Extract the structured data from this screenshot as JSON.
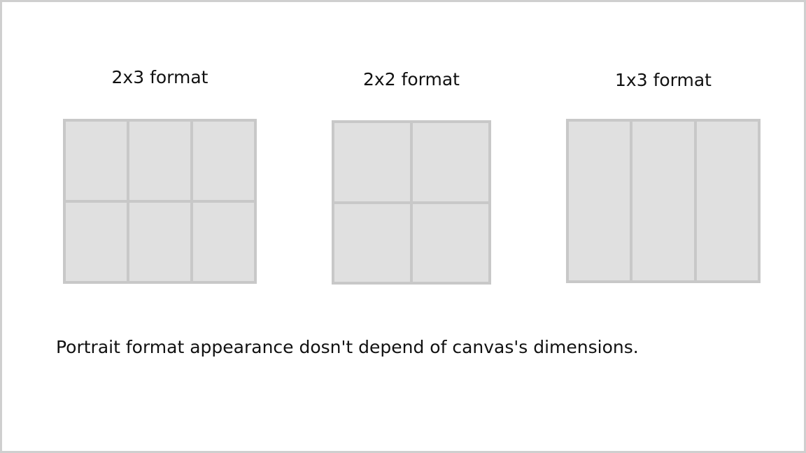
{
  "formats": [
    {
      "label": "2x3 format",
      "rows": 2,
      "cols": 3
    },
    {
      "label": "2x2 format",
      "rows": 2,
      "cols": 2
    },
    {
      "label": "1x3 format",
      "rows": 1,
      "cols": 3
    }
  ],
  "caption": "Portrait format appearance dosn't depend of canvas's dimensions.",
  "colors": {
    "frame": "#c8c8c8",
    "cell": "#e0e0e0",
    "text": "#111111"
  }
}
